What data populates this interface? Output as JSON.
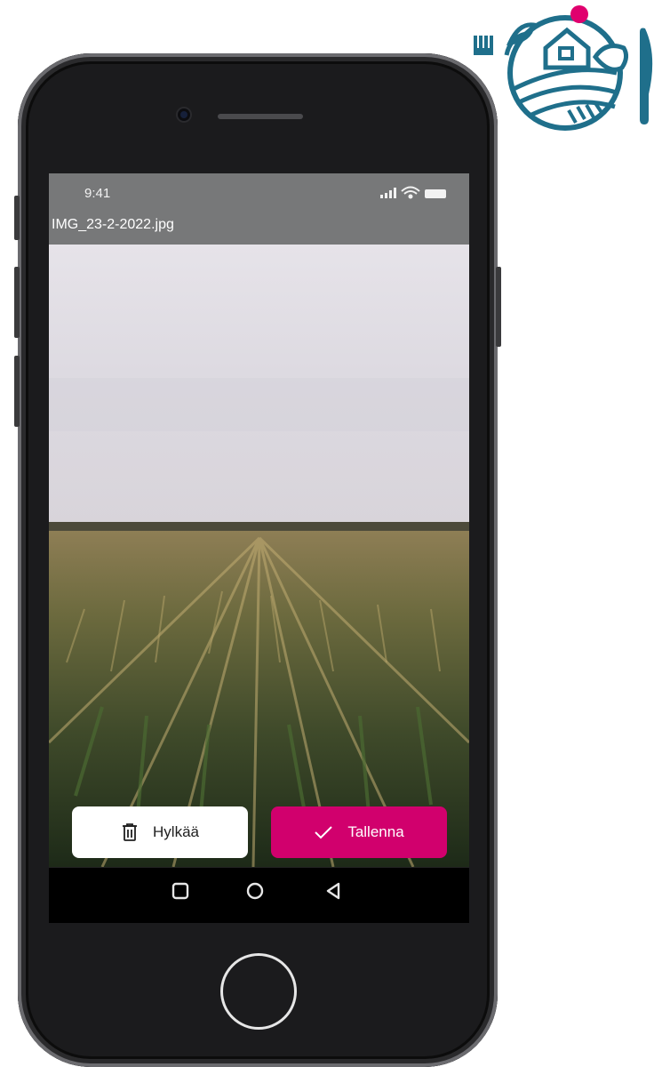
{
  "status_bar": {
    "time": "9:41"
  },
  "file": {
    "name": "IMG_23-2-2022.jpg"
  },
  "actions": {
    "reject_label": "Hylkää",
    "save_label": "Tallenna"
  },
  "colors": {
    "accent": "#d1006d",
    "logo": "#1f6f8b",
    "logo_dot": "#e0006e",
    "status_bar_bg": "#777879"
  },
  "icons": {
    "reject": "trash-icon",
    "save": "checkmark-icon",
    "nav_recent": "square-icon",
    "nav_home": "circle-icon",
    "nav_back": "triangle-back-icon"
  }
}
